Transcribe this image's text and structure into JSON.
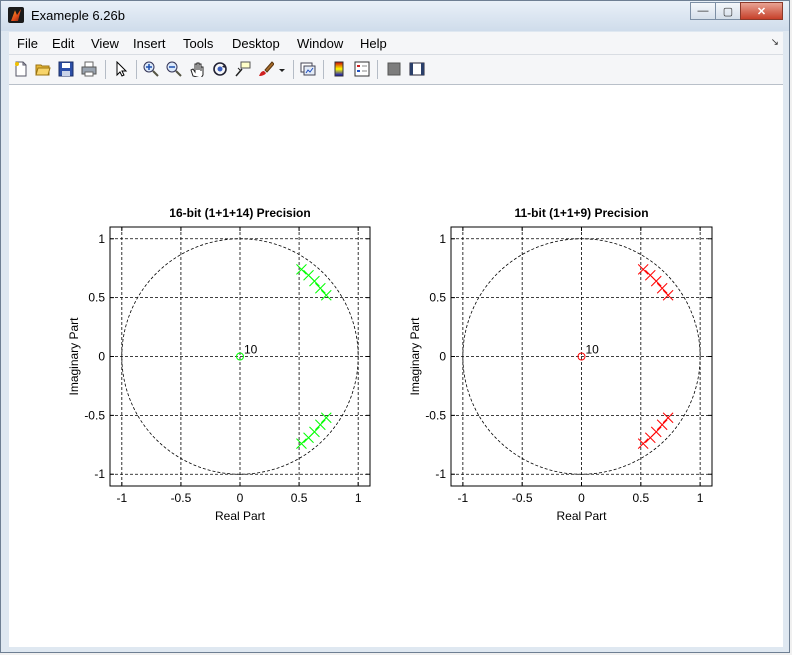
{
  "window": {
    "title": "Exameple 6.26b",
    "buttons": {
      "minimize": "—",
      "maximize": "▢",
      "close": "✕"
    }
  },
  "menu": [
    "File",
    "Edit",
    "View",
    "Insert",
    "Tools",
    "Desktop",
    "Window",
    "Help"
  ],
  "toolbar_icons": [
    "new-figure-icon",
    "open-file-icon",
    "save-icon",
    "print-icon",
    "select-arrow-icon",
    "zoom-in-icon",
    "zoom-out-icon",
    "pan-hand-icon",
    "rotate-3d-icon",
    "data-cursor-icon",
    "brush-icon",
    "brush-dropdown-icon",
    "link-plot-icon",
    "colorbar-icon",
    "legend-icon",
    "hide-plot-tools-icon",
    "show-plot-tools-icon"
  ],
  "chart_data": [
    {
      "type": "scatter",
      "title": "16-bit (1+1+14) Precision",
      "xlabel": "Real Part",
      "ylabel": "Imaginary Part",
      "xlim": [
        -1.1,
        1.1
      ],
      "ylim": [
        -1.1,
        1.1
      ],
      "xticks": [
        "-1",
        "-0.5",
        "0",
        "0.5",
        "1"
      ],
      "yticks": [
        "1",
        "0.5",
        "0",
        "-0.5",
        "-1"
      ],
      "grid": true,
      "unit_circle": true,
      "color": "#00ff00",
      "zeros": [
        {
          "x": 0,
          "y": 0,
          "multiplicity_label": "10"
        }
      ],
      "poles": [
        {
          "x": 0.52,
          "y": 0.74
        },
        {
          "x": 0.58,
          "y": 0.69
        },
        {
          "x": 0.63,
          "y": 0.64
        },
        {
          "x": 0.68,
          "y": 0.58
        },
        {
          "x": 0.73,
          "y": 0.52
        },
        {
          "x": 0.52,
          "y": -0.74
        },
        {
          "x": 0.58,
          "y": -0.69
        },
        {
          "x": 0.63,
          "y": -0.64
        },
        {
          "x": 0.68,
          "y": -0.58
        },
        {
          "x": 0.73,
          "y": -0.52
        }
      ]
    },
    {
      "type": "scatter",
      "title": "11-bit (1+1+9) Precision",
      "xlabel": "Real Part",
      "ylabel": "Imaginary Part",
      "xlim": [
        -1.1,
        1.1
      ],
      "ylim": [
        -1.1,
        1.1
      ],
      "xticks": [
        "-1",
        "-0.5",
        "0",
        "0.5",
        "1"
      ],
      "yticks": [
        "1",
        "0.5",
        "0",
        "-0.5",
        "-1"
      ],
      "grid": true,
      "unit_circle": true,
      "color": "#ff0000",
      "zeros": [
        {
          "x": 0,
          "y": 0,
          "multiplicity_label": "10"
        }
      ],
      "poles": [
        {
          "x": 0.52,
          "y": 0.74
        },
        {
          "x": 0.58,
          "y": 0.69
        },
        {
          "x": 0.63,
          "y": 0.64
        },
        {
          "x": 0.68,
          "y": 0.58
        },
        {
          "x": 0.73,
          "y": 0.52
        },
        {
          "x": 0.52,
          "y": -0.74
        },
        {
          "x": 0.58,
          "y": -0.69
        },
        {
          "x": 0.63,
          "y": -0.64
        },
        {
          "x": 0.68,
          "y": -0.58
        },
        {
          "x": 0.73,
          "y": -0.52
        }
      ]
    }
  ]
}
